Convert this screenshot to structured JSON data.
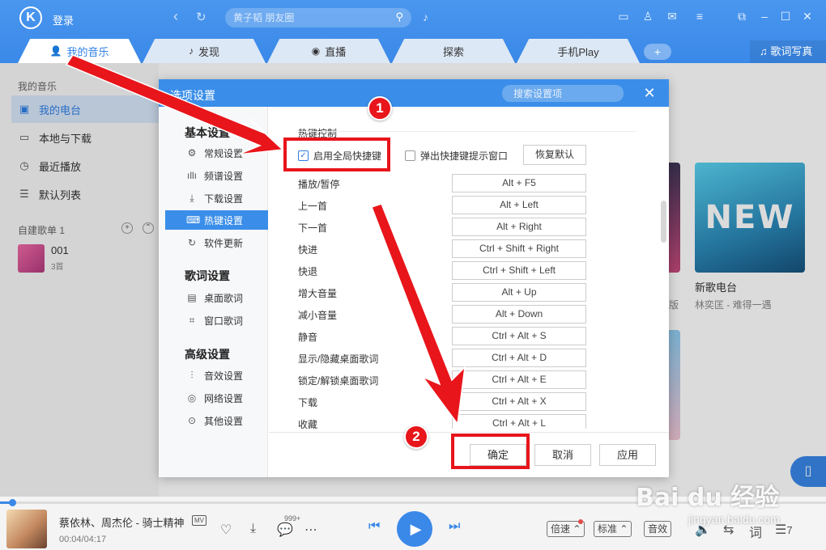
{
  "app": {
    "logo_letter": "K",
    "login": "登录",
    "search_placeholder": "黄子韬 朋友圈",
    "tabs": [
      {
        "label": "我的音乐",
        "icon": "user-icon"
      },
      {
        "label": "发现",
        "icon": "music-note-icon"
      },
      {
        "label": "直播",
        "icon": "live-icon"
      },
      {
        "label": "探索",
        "icon": ""
      },
      {
        "label": "手机Play",
        "icon": ""
      }
    ],
    "add_tab": "+",
    "lyrics_button": "歌词写真",
    "accent_color": "#3a88e8"
  },
  "leftnav": {
    "title": "我的音乐",
    "items": [
      {
        "label": "我的电台",
        "icon": "radio-icon"
      },
      {
        "label": "本地与下载",
        "icon": "monitor-icon"
      },
      {
        "label": "最近播放",
        "icon": "clock-icon"
      },
      {
        "label": "默认列表",
        "icon": "list-icon"
      }
    ],
    "playlist_header": "自建歌单",
    "playlist_count": "1",
    "playlist": {
      "name": "001",
      "count": "3首"
    }
  },
  "main": {
    "card_title": "新歌电台",
    "card_sub": "林奕匡 - 难得一遇",
    "card_edge_text": "版",
    "card_art_text": "NEW"
  },
  "dialog": {
    "title": "选项设置",
    "search_placeholder": "搜索设置项",
    "close": "✕",
    "sections": [
      {
        "header": "基本设置",
        "items": [
          {
            "label": "常规设置",
            "icon": "gear-icon"
          },
          {
            "label": "频谱设置",
            "icon": "spectrum-icon"
          },
          {
            "label": "下载设置",
            "icon": "download-icon"
          },
          {
            "label": "热键设置",
            "icon": "keyboard-icon",
            "active": true
          },
          {
            "label": "软件更新",
            "icon": "update-icon"
          }
        ]
      },
      {
        "header": "歌词设置",
        "items": [
          {
            "label": "桌面歌词",
            "icon": "desktop-lyrics-icon"
          },
          {
            "label": "窗口歌词",
            "icon": "window-lyrics-icon"
          }
        ]
      },
      {
        "header": "高级设置",
        "items": [
          {
            "label": "音效设置",
            "icon": "equalizer-icon"
          },
          {
            "label": "网络设置",
            "icon": "globe-icon"
          },
          {
            "label": "其他设置",
            "icon": "more-icon"
          }
        ]
      }
    ],
    "hotkey": {
      "title": "热键控制",
      "enable_global": {
        "label": "启用全局快捷键",
        "checked": true
      },
      "popup_hint": {
        "label": "弹出快捷键提示窗口",
        "checked": false
      },
      "reset": "恢复默认",
      "rows": [
        {
          "label": "播放/暂停",
          "keys": "Alt + F5"
        },
        {
          "label": "上一首",
          "keys": "Alt + Left"
        },
        {
          "label": "下一首",
          "keys": "Alt + Right"
        },
        {
          "label": "快进",
          "keys": "Ctrl + Shift + Right"
        },
        {
          "label": "快退",
          "keys": "Ctrl + Shift + Left"
        },
        {
          "label": "增大音量",
          "keys": "Alt + Up"
        },
        {
          "label": "减小音量",
          "keys": "Alt + Down"
        },
        {
          "label": "静音",
          "keys": "Ctrl + Alt + S"
        },
        {
          "label": "显示/隐藏桌面歌词",
          "keys": "Ctrl + Alt + D"
        },
        {
          "label": "锁定/解锁桌面歌词",
          "keys": "Ctrl + Alt + E"
        },
        {
          "label": "下载",
          "keys": "Ctrl + Alt + X"
        },
        {
          "label": "收藏",
          "keys": "Ctrl + Alt + L"
        }
      ]
    },
    "buttons": {
      "ok": "确定",
      "cancel": "取消",
      "apply": "应用"
    }
  },
  "player": {
    "song": "蔡依林、周杰伦 - 骑士精神",
    "mv": "MV",
    "time": "00:04/04:17",
    "progress": 0.015,
    "comments": "999+",
    "speed": "倍速",
    "quality": "标准",
    "sound": "音效",
    "playlist_count": "7"
  },
  "tutorial": {
    "step1": "1",
    "step2": "2",
    "arrow_color": "#e8151b"
  },
  "watermark": {
    "brand": "Bai du 经验",
    "url": "jingyan.baidu.com"
  }
}
